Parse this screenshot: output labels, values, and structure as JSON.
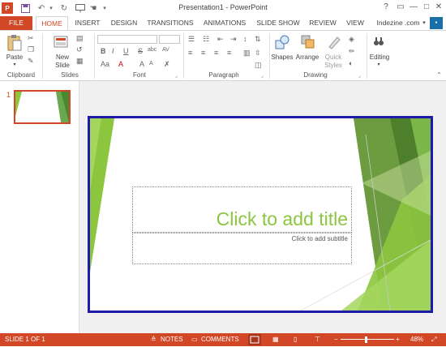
{
  "titlebar": {
    "title": "Presentation1 - PowerPoint",
    "controls": [
      "?",
      "▭",
      "—",
      "□",
      "✕"
    ]
  },
  "tabs": [
    {
      "label": "FILE"
    },
    {
      "label": "HOME"
    },
    {
      "label": "INSERT"
    },
    {
      "label": "DESIGN"
    },
    {
      "label": "TRANSITIONS"
    },
    {
      "label": "ANIMATIONS"
    },
    {
      "label": "SLIDE SHOW"
    },
    {
      "label": "REVIEW"
    },
    {
      "label": "VIEW"
    }
  ],
  "account": {
    "name": "Indezine .com",
    "arrow": "▾"
  },
  "ribbon": {
    "clipboard": {
      "paste": "Paste",
      "label": "Clipboard"
    },
    "slides": {
      "new_slide": "New",
      "new_slide_2": "Slide",
      "label": "Slides"
    },
    "font": {
      "bold": "B",
      "italic": "I",
      "underline": "U",
      "strike": "S",
      "shadow": "abc",
      "spacing": "AV",
      "case": "Aa",
      "color": "A",
      "grow": "A",
      "shrink": "A",
      "label": "Font"
    },
    "paragraph": {
      "label": "Paragraph"
    },
    "drawing": {
      "shapes": "Shapes",
      "arrange": "Arrange",
      "quick": "Quick",
      "styles": "Styles",
      "label": "Drawing"
    },
    "editing": {
      "label": "Editing"
    }
  },
  "thumbnail": {
    "number": "1"
  },
  "slide": {
    "title_placeholder": "Click to add title",
    "subtitle_placeholder": "Click to add subtitle"
  },
  "status": {
    "slide_info": "SLIDE 1 OF 1",
    "notes": "NOTES",
    "comments": "COMMENTS",
    "zoom": "48%"
  },
  "colors": {
    "accent": "#d24726",
    "slide_border": "#1f1aa8",
    "title_green": "#8cc63f"
  }
}
